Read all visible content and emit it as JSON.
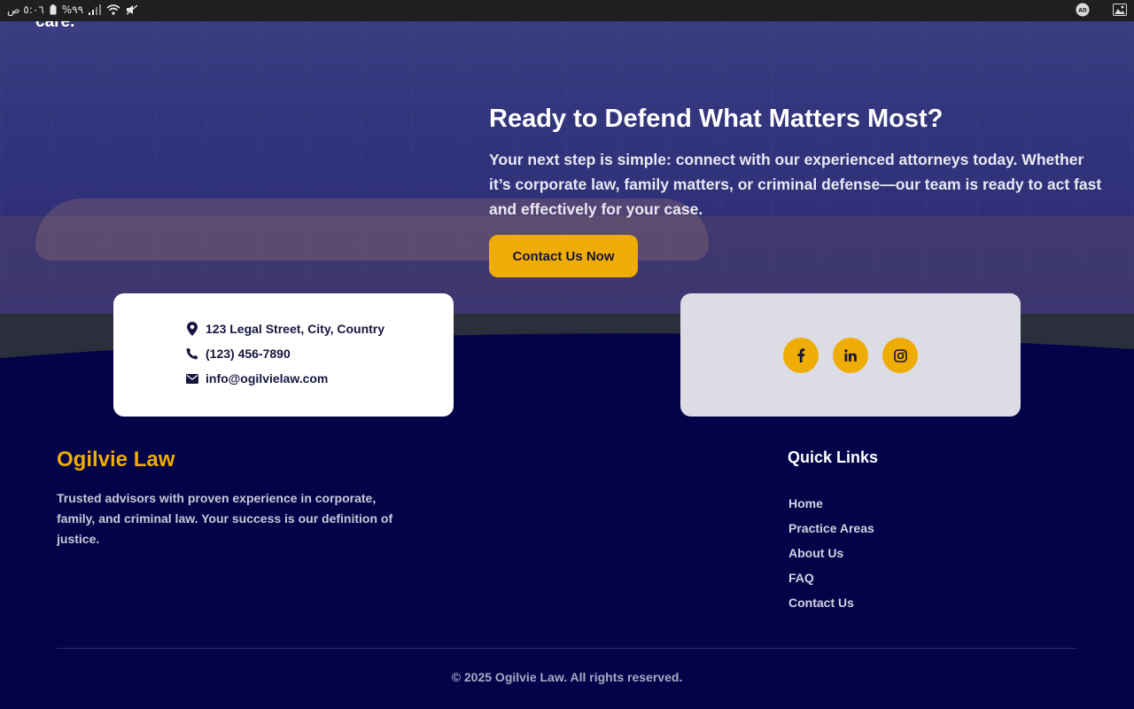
{
  "status_bar": {
    "time": "٥:٠٦ ص",
    "battery": "%٩٩",
    "icons": [
      "battery-icon",
      "signal-icon",
      "wifi-icon",
      "mute-icon",
      "ad-block-icon",
      "image-icon"
    ]
  },
  "hero": {
    "fragment_text": "care.",
    "title": "Ready to Defend What Matters Most?",
    "description": "Your next step is simple: connect with our experienced attorneys today. Whether it’s corporate law, family matters, or criminal defense—our team is ready to act fast and effectively for your case.",
    "cta_label": "Contact Us Now"
  },
  "contact": {
    "address": "123 Legal Street, City, Country",
    "phone": "(123) 456-7890",
    "email": "info@ogilvielaw.com"
  },
  "social": {
    "links": [
      "facebook-icon",
      "linkedin-icon",
      "instagram-icon"
    ]
  },
  "footer": {
    "brand": "Ogilvie Law",
    "description": "Trusted advisors with proven experience in corporate, family, and criminal law. Your success is our definition of justice.",
    "quick_links_title": "Quick Links",
    "quick_links": [
      "Home",
      "Practice Areas",
      "About Us",
      "FAQ",
      "Contact Us"
    ],
    "copyright": "© 2025 Ogilvie Law. All rights reserved."
  },
  "colors": {
    "accent": "#eeac04",
    "footer_bg": "#03034a",
    "hero_overlay": "#262676"
  }
}
